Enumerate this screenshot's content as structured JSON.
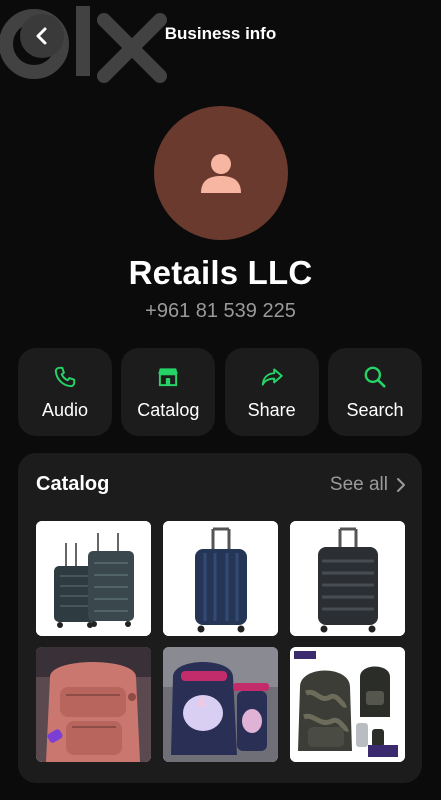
{
  "header": {
    "title": "Business info",
    "back_icon": "chevron-left-icon",
    "watermark": "olx"
  },
  "profile": {
    "avatar_icon": "person-icon",
    "name": "Retails LLC",
    "phone": "+961 81 539 225"
  },
  "actions": [
    {
      "label": "Audio",
      "icon": "phone-icon"
    },
    {
      "label": "Catalog",
      "icon": "store-icon"
    },
    {
      "label": "Share",
      "icon": "share-icon"
    },
    {
      "label": "Search",
      "icon": "search-icon"
    }
  ],
  "catalog": {
    "title": "Catalog",
    "see_all": "See all",
    "items": [
      {
        "name": "dark-luggage-set-photo"
      },
      {
        "name": "navy-suitcase-photo"
      },
      {
        "name": "black-suitcase-photo"
      },
      {
        "name": "pink-backpack-photo"
      },
      {
        "name": "unicorn-school-bag-set-photo"
      },
      {
        "name": "camo-backpack-set-photo"
      }
    ]
  },
  "colors": {
    "background": "#0b0b0b",
    "card": "#1c1c1c",
    "accent_green": "#25d366",
    "avatar_bg": "#6b3a2e",
    "avatar_fg": "#f7b6a2",
    "muted_text": "#9a9a9a"
  }
}
